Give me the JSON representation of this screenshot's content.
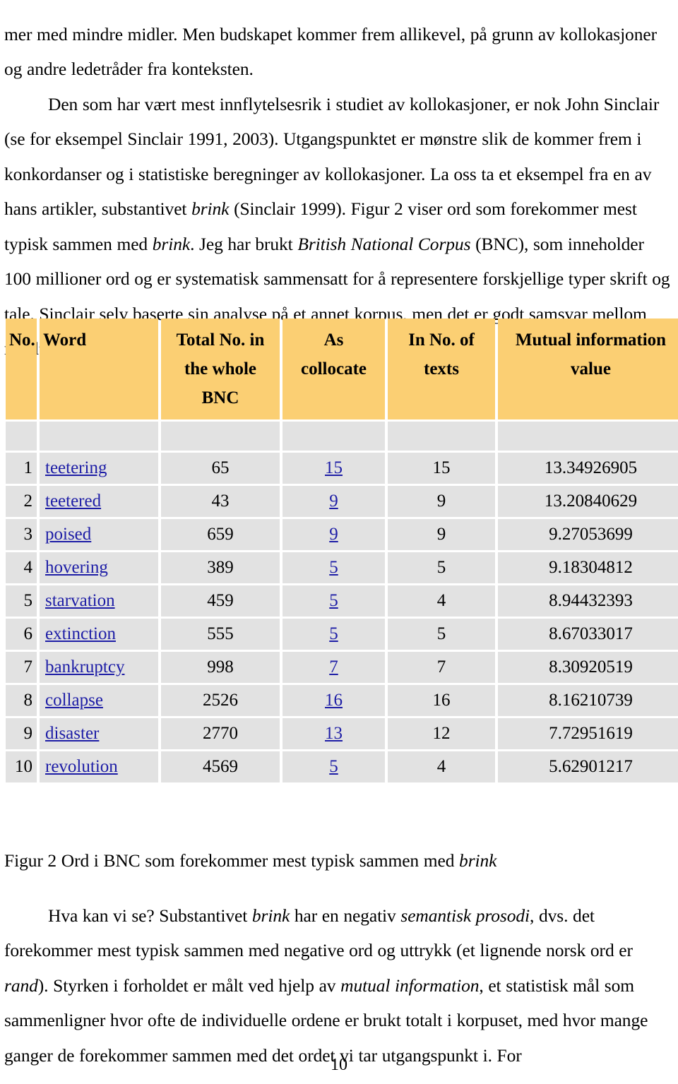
{
  "document": {
    "paragraphs": {
      "top": {
        "segments": [
          {
            "t": "mer med mindre midler. Men budskapet kommer frem allikevel, på grunn av kollokasjoner og andre ledetråder fra konteksten.",
            "style": "normal"
          },
          {
            "t": "BREAK",
            "style": "break"
          },
          {
            "t": "INDENT",
            "style": "indent"
          },
          {
            "t": "Den som har vært mest innflytelsesrik i studiet av kollokasjoner, er nok John Sinclair (se for eksempel Sinclair 1991, 2003). Utgangspunktet er mønstre slik de kommer frem i konkordanser og i statistiske beregninger av kollokasjoner. La oss ta et eksempel fra en av hans artikler, substantivet ",
            "style": "normal"
          },
          {
            "t": "brink",
            "style": "italic"
          },
          {
            "t": " (Sinclair 1999). Figur 2 viser ord som forekommer mest typisk sammen med ",
            "style": "normal"
          },
          {
            "t": "brink",
            "style": "italic"
          },
          {
            "t": ". Jeg har brukt ",
            "style": "normal"
          },
          {
            "t": "British National Corpus",
            "style": "italic"
          },
          {
            "t": " (BNC), som inneholder 100 millioner ord og er systematisk sammensatt for å representere forskjellige typer skrift og tale. Sinclair selv baserte sin analyse på et annet korpus, men det er godt samsvar mellom resultatene.",
            "style": "normal"
          }
        ]
      },
      "caption": {
        "segments": [
          {
            "t": "Figur 2 Ord i BNC som forekommer mest typisk sammen med ",
            "style": "normal"
          },
          {
            "t": "brink",
            "style": "italic"
          }
        ]
      },
      "bottom": {
        "segments": [
          {
            "t": "INDENT",
            "style": "indent"
          },
          {
            "t": "Hva kan vi se? Substantivet ",
            "style": "normal"
          },
          {
            "t": "brink",
            "style": "italic"
          },
          {
            "t": " har en negativ ",
            "style": "normal"
          },
          {
            "t": "semantisk prosodi",
            "style": "italic"
          },
          {
            "t": ", dvs. det forekommer mest typisk sammen med negative ord og uttrykk (et lignende norsk ord er ",
            "style": "normal"
          },
          {
            "t": "rand",
            "style": "italic"
          },
          {
            "t": "). Styrken i forholdet er målt ved hjelp av ",
            "style": "normal"
          },
          {
            "t": "mutual information",
            "style": "italic"
          },
          {
            "t": ", et statistisk mål som sammenligner hvor ofte de individuelle ordene er brukt totalt i korpuset, med hvor mange ganger de forekommer sammen med det ordet vi tar utgangspunkt i. For",
            "style": "normal"
          }
        ]
      }
    },
    "page_number": "10"
  },
  "colors": {
    "header_background": "#fbcf73",
    "cell_background": "#e2e2e2",
    "link": "#1d1da6",
    "text": "#000000",
    "page_background": "#ffffff"
  },
  "chart_data": {
    "type": "table",
    "title": "Figur 2 Ord i BNC som forekommer mest typisk sammen med brink",
    "columns": [
      {
        "key": "no",
        "label": "No.",
        "align": "left"
      },
      {
        "key": "word",
        "label": "Word",
        "align": "left"
      },
      {
        "key": "total",
        "label": "Total No. in the whole BNC",
        "align": "center"
      },
      {
        "key": "collocate",
        "label": "As collocate",
        "align": "center"
      },
      {
        "key": "texts",
        "label": "In No. of texts",
        "align": "center"
      },
      {
        "key": "mi",
        "label": "Mutual information value",
        "align": "center"
      }
    ],
    "header_lines": {
      "no": [
        "No."
      ],
      "word": [
        "Word"
      ],
      "total": [
        "Total No. in",
        "the whole",
        "BNC"
      ],
      "collocate": [
        "As",
        "collocate"
      ],
      "texts": [
        "In No. of",
        "texts"
      ],
      "mi": [
        "Mutual information",
        "value"
      ]
    },
    "rows": [
      {
        "no": "1",
        "word": "teetering",
        "total": "65",
        "collocate": "15",
        "texts": "15",
        "mi": "13.34926905"
      },
      {
        "no": "2",
        "word": "teetered",
        "total": "43",
        "collocate": "9",
        "texts": "9",
        "mi": "13.20840629"
      },
      {
        "no": "3",
        "word": "poised",
        "total": "659",
        "collocate": "9",
        "texts": "9",
        "mi": "9.27053699"
      },
      {
        "no": "4",
        "word": "hovering",
        "total": "389",
        "collocate": "5",
        "texts": "5",
        "mi": "9.18304812"
      },
      {
        "no": "5",
        "word": "starvation",
        "total": "459",
        "collocate": "5",
        "texts": "4",
        "mi": "8.94432393"
      },
      {
        "no": "6",
        "word": "extinction",
        "total": "555",
        "collocate": "5",
        "texts": "5",
        "mi": "8.67033017"
      },
      {
        "no": "7",
        "word": "bankruptcy",
        "total": "998",
        "collocate": "7",
        "texts": "7",
        "mi": "8.30920519"
      },
      {
        "no": "8",
        "word": "collapse",
        "total": "2526",
        "collocate": "16",
        "texts": "16",
        "mi": "8.16210739"
      },
      {
        "no": "9",
        "word": "disaster",
        "total": "2770",
        "collocate": "13",
        "texts": "12",
        "mi": "7.72951619"
      },
      {
        "no": "10",
        "word": "revolution",
        "total": "4569",
        "collocate": "5",
        "texts": "4",
        "mi": "5.62901217"
      }
    ],
    "link_columns": [
      "word",
      "collocate"
    ]
  }
}
